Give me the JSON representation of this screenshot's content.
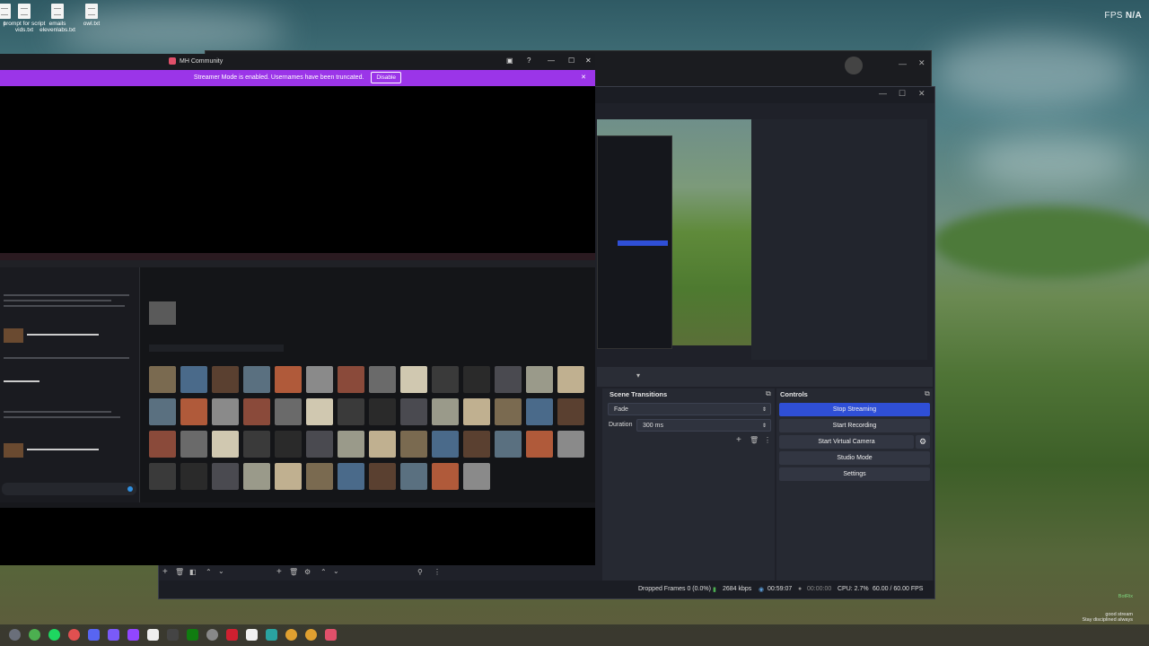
{
  "desktop": {
    "icons": [
      {
        "label": "t"
      },
      {
        "label": "prompt for script vids.txt"
      },
      {
        "label": "emails elevenlabs.txt"
      },
      {
        "label": "owl.txt"
      }
    ],
    "fps_label": "FPS",
    "fps_value": "N/A"
  },
  "obs": {
    "scene_transitions": {
      "title": "Scene Transitions",
      "transition": "Fade",
      "duration_label": "Duration",
      "duration_value": "300 ms"
    },
    "controls": {
      "title": "Controls",
      "stop_streaming": "Stop Streaming",
      "start_recording": "Start Recording",
      "start_virtual_camera": "Start Virtual Camera",
      "studio_mode": "Studio Mode",
      "settings": "Settings"
    },
    "status": {
      "dropped_frames": "Dropped Frames 0 (0.0%)",
      "bitrate": "2684 kbps",
      "stream_time": "00:59:07",
      "record_time": "00:00:00",
      "cpu": "CPU: 2.7%",
      "fps": "60.00 / 60.00 FPS"
    }
  },
  "discord": {
    "title": "MH Community",
    "banner": "Streamer Mode is enabled. Usernames have been truncated.",
    "disable_label": "Disable",
    "close_symbol": "✕"
  },
  "chat_overlay": {
    "lines": [
      {
        "text": "BotRix"
      },
      {
        "text": "good stream"
      },
      {
        "text": "Stay disciplined always"
      }
    ]
  },
  "colors": {
    "discord_banner": "#9b35e8",
    "obs_primary": "#2f4fd6"
  }
}
